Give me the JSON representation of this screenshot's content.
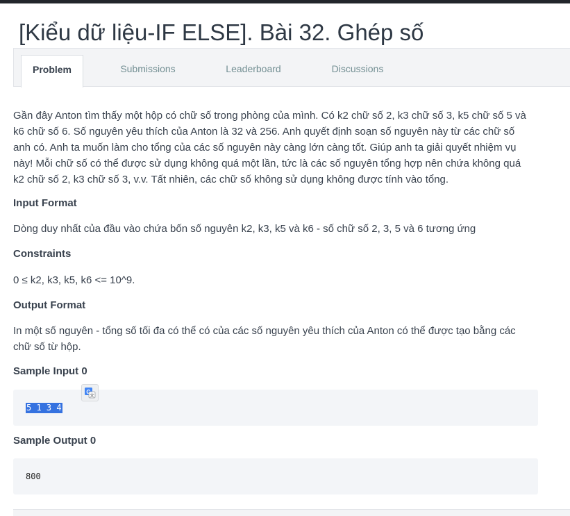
{
  "page": {
    "title": "[Kiểu dữ liệu-IF ELSE]. Bài 32. Ghép số"
  },
  "tabs": [
    {
      "label": "Problem",
      "active": true
    },
    {
      "label": "Submissions",
      "active": false
    },
    {
      "label": "Leaderboard",
      "active": false
    },
    {
      "label": "Discussions",
      "active": false
    }
  ],
  "problem": {
    "statement_lines": [
      "Gần đây Anton tìm thấy một hộp có chữ số trong phòng của mình. Có k2 chữ số 2, k3 chữ số 3, k5 chữ số 5 và",
      "k6 chữ số 6. Số nguyên yêu thích của Anton là 32 và 256. Anh quyết định soạn số nguyên này từ các chữ số",
      "anh có. Anh ta muốn làm cho tổng của các số nguyên này càng lớn càng tốt. Giúp anh ta giải quyết nhiệm vụ",
      "này! Mỗi chữ số có thể được sử dụng không quá một lần, tức là các số nguyên tổng hợp nên chứa không quá",
      "k2 chữ số 2, k3 chữ số 3, v.v. Tất nhiên, các chữ số không sử dụng không được tính vào tổng."
    ],
    "input_format_heading": "Input Format",
    "input_format_text": "Dòng duy nhất của đầu vào chứa bốn số nguyên k2, k3, k5 và k6 - số chữ số 2, 3, 5 và 6 tương ứng",
    "constraints_heading": "Constraints",
    "constraints_text": "0 ≤ k2, k3, k5, k6 <= 10^9.",
    "output_format_heading": "Output Format",
    "output_format_lines": [
      "In một số nguyên - tổng số tối đa có thể có của các số nguyên yêu thích của Anton có thể được tạo bằng các",
      "chữ số từ hộp."
    ],
    "sample_input_heading": "Sample Input 0",
    "sample_input": "5 1 3 4",
    "sample_output_heading": "Sample Output 0",
    "sample_output": "800"
  },
  "icons": {
    "translate": "google-translate-icon"
  },
  "colors": {
    "selection": "#3572e0",
    "code_bg": "#f3f5f8",
    "tabbar_bg": "#f3f4f6"
  }
}
